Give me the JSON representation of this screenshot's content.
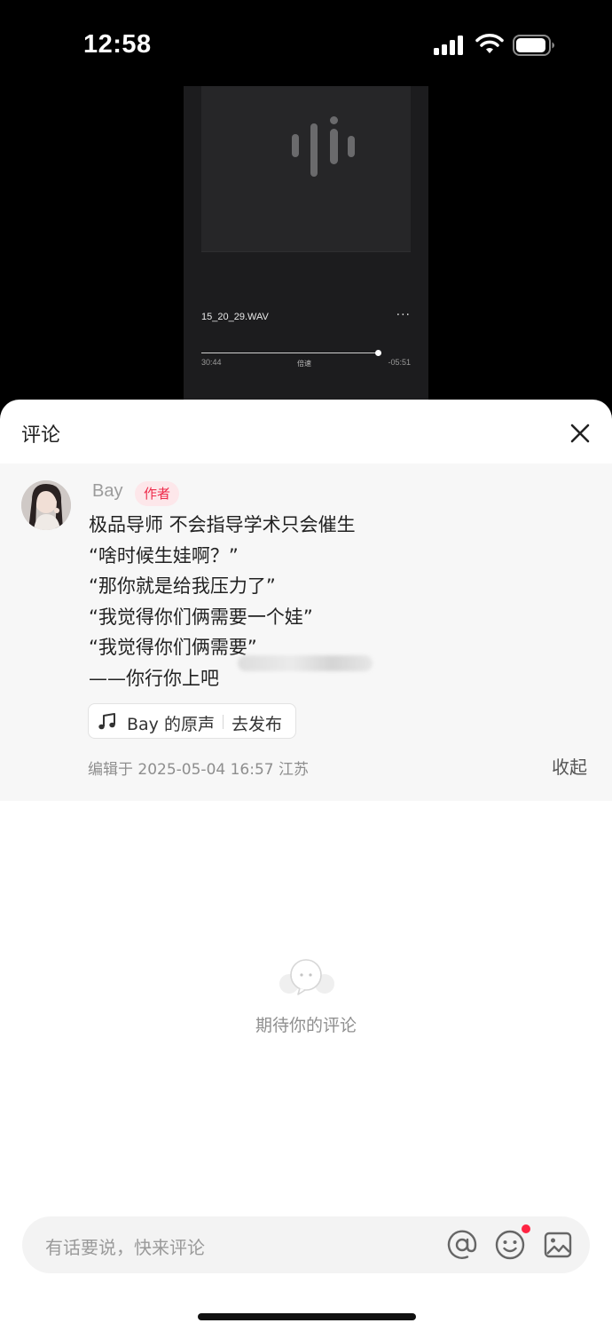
{
  "status_bar": {
    "time": "12:58"
  },
  "preview": {
    "file_name": "15_20_29.WAV",
    "more_label": "···",
    "elapsed": "30:44",
    "speed_label": "倍速",
    "remaining": "-05:51",
    "progress_fraction": 0.84
  },
  "sheet": {
    "title": "评论"
  },
  "comment": {
    "username": "Bay",
    "author_tag": "作者",
    "lines": [
      "极品导师 不会指导学术只会催生",
      "“啥时候生娃啊？”",
      "“那你就是给我压力了”",
      "“我觉得你们俩需要一个娃”",
      "“我觉得你们俩需要”",
      "——你行你上吧"
    ],
    "sound_name": "Bay 的原声",
    "publish_label": "去发布",
    "meta": "编辑于  2025-05-04 16:57 江苏",
    "collapse_label": "收起"
  },
  "empty_state": {
    "text": "期待你的评论"
  },
  "input": {
    "placeholder": "有话要说，快来评论"
  },
  "colors": {
    "accent": "#ff2442",
    "author_tag_bg": "#fde7ea",
    "author_tag_text": "#ee2a4a"
  },
  "icons": {
    "close": "close-icon",
    "music": "music-note-icon",
    "at": "at-icon",
    "emoji": "emoji-icon",
    "image": "image-icon"
  }
}
